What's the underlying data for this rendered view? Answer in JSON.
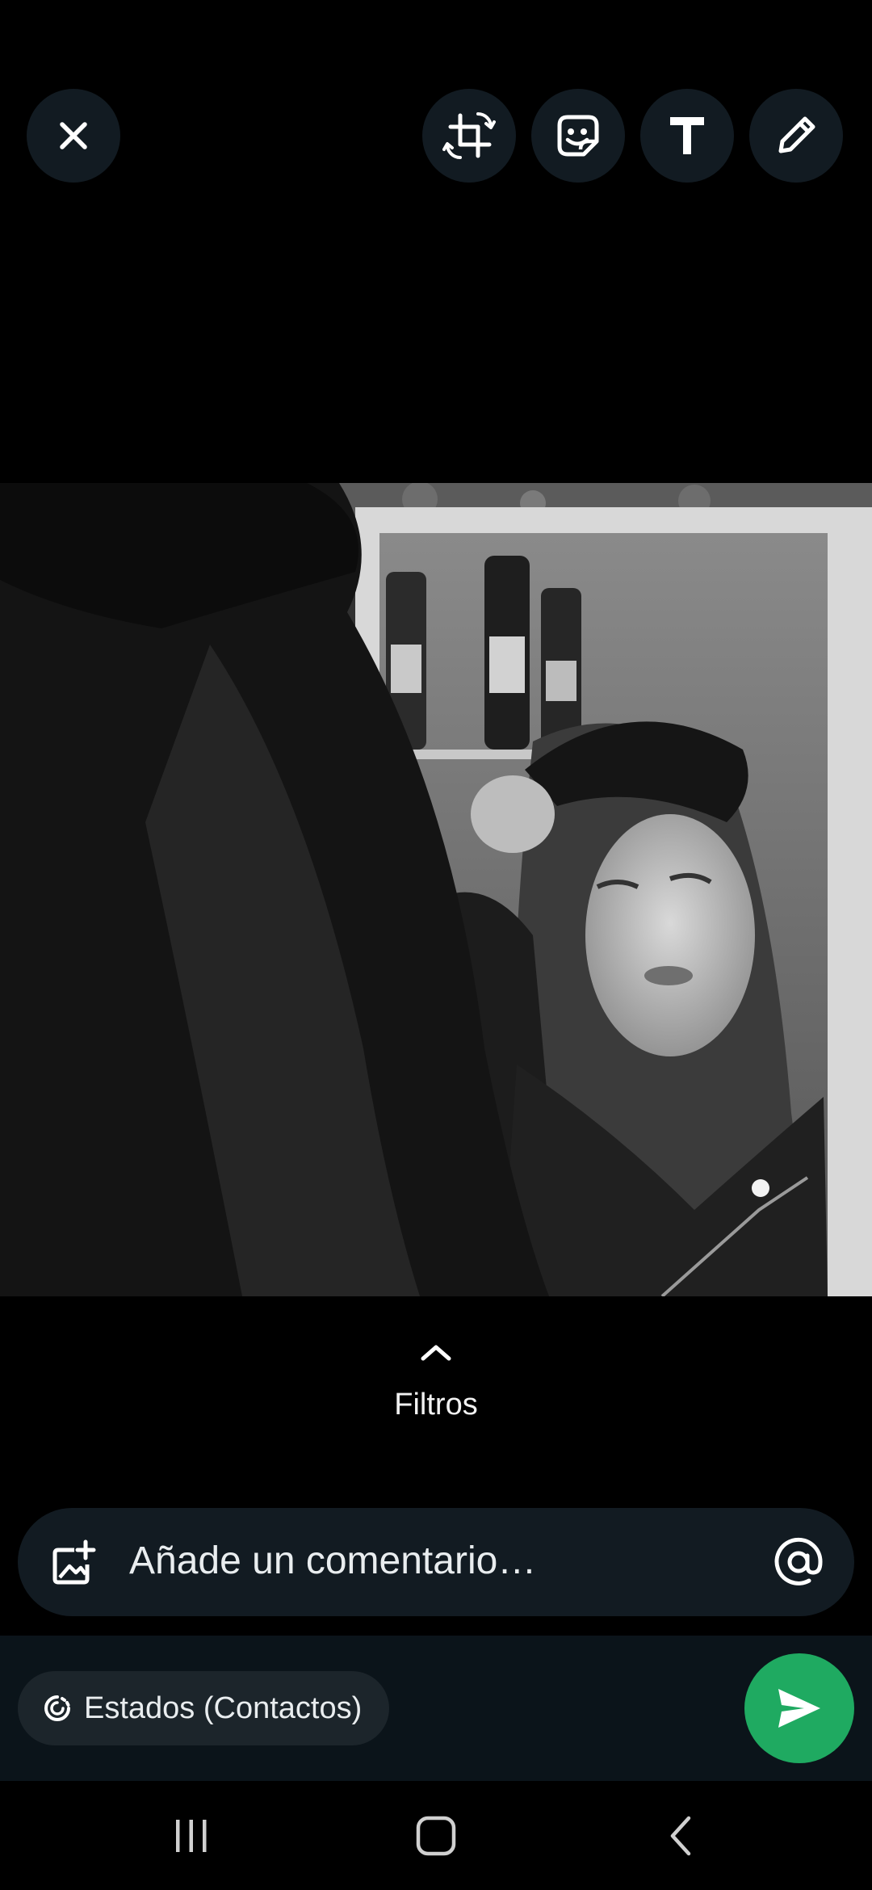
{
  "toolbar": {
    "close_icon": "close-icon",
    "crop_icon": "crop-rotate-icon",
    "sticker_icon": "sticker-icon",
    "text_icon": "text-icon",
    "draw_icon": "pencil-icon"
  },
  "photo": {
    "description_icon": "photo"
  },
  "filters": {
    "label": "Filtros",
    "icon": "chevron-up-icon"
  },
  "comment": {
    "placeholder": "Añade un comentario…",
    "left_icon": "add-media-icon",
    "right_icon": "mention-icon"
  },
  "status": {
    "label": "Estados (Contactos)",
    "icon": "status-icon"
  },
  "send": {
    "icon": "send-icon",
    "color": "#1faa61"
  },
  "navbar": {
    "recents_icon": "recents-icon",
    "home_icon": "home-icon",
    "back_icon": "back-icon"
  },
  "colors": {
    "background": "#000000",
    "surface": "#121b22",
    "panel": "#0b141a",
    "accent": "#1faa61"
  }
}
